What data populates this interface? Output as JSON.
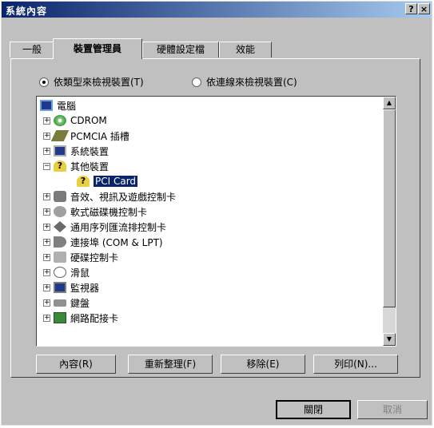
{
  "window": {
    "title": "系統內容"
  },
  "titlebar": {
    "help_glyph": "?",
    "close_glyph": "×"
  },
  "tabs": [
    {
      "label": "一般"
    },
    {
      "label": "裝置管理員"
    },
    {
      "label": "硬體設定檔"
    },
    {
      "label": "效能"
    }
  ],
  "view_options": [
    {
      "label": "依類型來檢視裝置(T)",
      "selected": true
    },
    {
      "label": "依連線來檢視裝置(C)",
      "selected": false
    }
  ],
  "tree": {
    "root": "電腦",
    "items": [
      {
        "label": "CDROM",
        "icon": "cdrom-icon"
      },
      {
        "label": "PCMCIA 插槽",
        "icon": "pcmcia-icon"
      },
      {
        "label": "系統裝置",
        "icon": "system-icon"
      },
      {
        "label": "其他裝置",
        "icon": "question-icon",
        "expanded": true
      },
      {
        "label": "PCI Card",
        "icon": "question-icon",
        "child": true,
        "selected": true
      },
      {
        "label": "音效、視訊及遊戲控制卡",
        "icon": "sound-icon"
      },
      {
        "label": "軟式磁碟機控制卡",
        "icon": "disk-icon"
      },
      {
        "label": "通用序列匯流排控制卡",
        "icon": "usb-icon"
      },
      {
        "label": "連接埠 (COM & LPT)",
        "icon": "port-icon"
      },
      {
        "label": "硬碟控制卡",
        "icon": "hdd-icon"
      },
      {
        "label": "滑鼠",
        "icon": "mouse-icon"
      },
      {
        "label": "監視器",
        "icon": "display-icon"
      },
      {
        "label": "鍵盤",
        "icon": "keyboard-icon"
      },
      {
        "label": "網路配接卡",
        "icon": "network-icon"
      }
    ]
  },
  "buttons": {
    "properties": "內容(R)",
    "refresh": "重新整理(F)",
    "remove": "移除(E)",
    "print": "列印(N)..."
  },
  "footer": {
    "close": "關閉",
    "cancel": "取消"
  }
}
